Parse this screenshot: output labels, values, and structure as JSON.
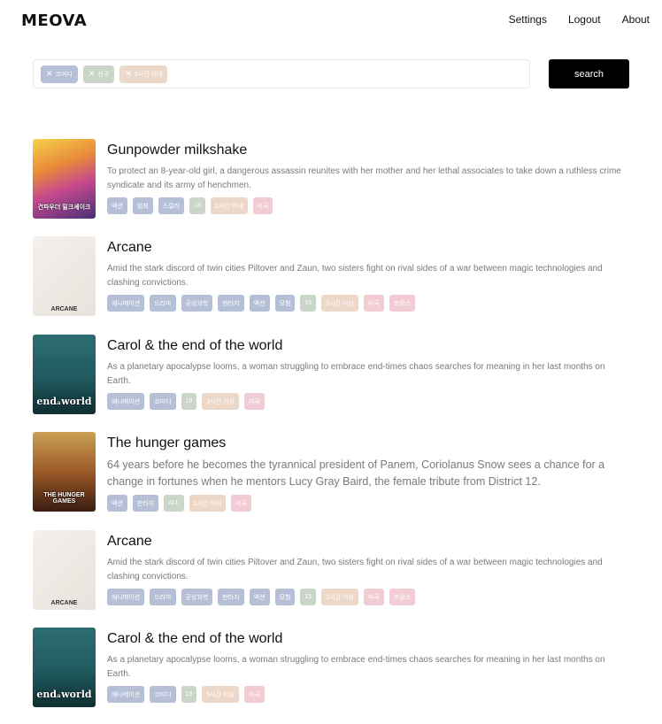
{
  "header": {
    "logo": "MEOVA",
    "nav": [
      "Settings",
      "Logout",
      "About"
    ]
  },
  "search": {
    "chips": [
      {
        "label": "코미디",
        "color": "#b5bfd6"
      },
      {
        "label": "친구",
        "color": "#c9d6c8"
      },
      {
        "label": "3시간 이내",
        "color": "#ecd8c9"
      }
    ],
    "button_label": "search"
  },
  "movies": [
    {
      "title": "Gunpowder milkshake",
      "description": "To protect an 8-year-old girl, a dangerous assassin reunites with her mother and her lethal associates to take down a ruthless crime syndicate and its army of henchmen.",
      "genres": [
        "액션",
        "범죄",
        "스릴러"
      ],
      "rating": "18",
      "runtime": "2시간 이내",
      "countries": [
        "미국"
      ],
      "poster_text": "건파우더 밀크셰이크"
    },
    {
      "title": "Arcane",
      "description": "Amid the stark discord of twin cities Piltover and Zaun, two sisters fight on rival sides of a war between magic technologies and clashing convictions.",
      "genres": [
        "애니메이션",
        "드라마",
        "공상과학",
        "판타지",
        "액션",
        "모험"
      ],
      "rating": "15",
      "runtime": "3시간 이상",
      "countries": [
        "미국",
        "프랑스"
      ],
      "poster_text": "ARCANE"
    },
    {
      "title": "Carol & the end of the world",
      "description": "As a planetary apocalypse looms, a woman struggling to embrace end-times chaos searches for meaning in her last months on Earth.",
      "genres": [
        "애니메이션",
        "코미디"
      ],
      "rating": "19",
      "runtime": "3시간 이상",
      "countries": [
        "미국"
      ],
      "poster_text": "endₐworld"
    },
    {
      "title": "The hunger games",
      "description": "64 years before he becomes the tyrannical president of Panem, Coriolanus Snow sees a chance for a change in fortunes when he mentors Lucy Gray Baird, the female tribute from District 12.",
      "genres": [
        "액션",
        "판타지"
      ],
      "rating": "ALL",
      "runtime": "2시간 이내",
      "countries": [
        "미국"
      ],
      "poster_text": "THE HUNGER GAMES"
    },
    {
      "title": "Arcane",
      "description": "Amid the stark discord of twin cities Piltover and Zaun, two sisters fight on rival sides of a war between magic technologies and clashing convictions.",
      "genres": [
        "애니메이션",
        "드라마",
        "공상과학",
        "판타지",
        "액션",
        "모험"
      ],
      "rating": "15",
      "runtime": "3시간 이상",
      "countries": [
        "미국",
        "프랑스"
      ],
      "poster_text": "ARCANE"
    },
    {
      "title": "Carol & the end of the world",
      "description": "As a planetary apocalypse looms, a woman struggling to embrace end-times chaos searches for meaning in her last months on Earth.",
      "genres": [
        "애니메이션",
        "코미디"
      ],
      "rating": "19",
      "runtime": "3시간 이상",
      "countries": [
        "미국"
      ],
      "poster_text": "endₐworld"
    }
  ]
}
